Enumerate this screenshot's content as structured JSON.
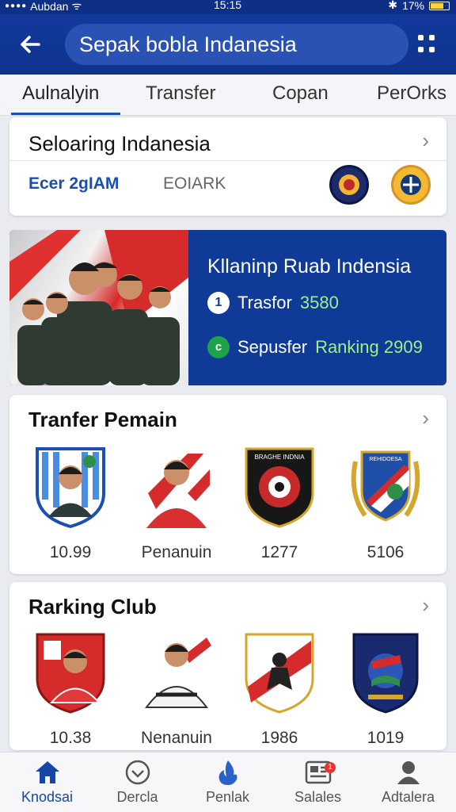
{
  "status": {
    "carrier": "Aubdan",
    "time": "15:15",
    "battery": "17%"
  },
  "header": {
    "search_text": "Sepak bobla Indanesia"
  },
  "tabs": [
    {
      "label": "Aulnalyin",
      "active": true
    },
    {
      "label": "Transfer",
      "active": false
    },
    {
      "label": "Copan",
      "active": false
    },
    {
      "label": "PerOrks",
      "active": false
    }
  ],
  "standings": {
    "title": "Seloaring Indanesia",
    "link": "Ecer 2gIAM",
    "sub": "EOIARK"
  },
  "banner": {
    "title": "Kllaninp Ruab Indensia",
    "row1_label": "Trasfor",
    "row1_value": "3580",
    "row1_icon": "1",
    "row2_label": "Sepusfer",
    "row2_value": "Ranking 2909",
    "row2_icon": "c"
  },
  "transfer": {
    "title": "Tranfer Pemain",
    "items": [
      {
        "value": "10.99",
        "icon": "player-crest-blue"
      },
      {
        "value": "Penanuin",
        "icon": "player-red"
      },
      {
        "value": "1277",
        "icon": "club-crest-black",
        "crest_text": "BRAGHE INDNIA"
      },
      {
        "value": "5106",
        "icon": "club-crest-wreath",
        "crest_text": "REHIDOESA"
      }
    ]
  },
  "ranking": {
    "title": "Rarking Club",
    "items": [
      {
        "value": "10.38",
        "icon": "player-crest-red"
      },
      {
        "value": "Nenanuin",
        "icon": "player-white"
      },
      {
        "value": "1986",
        "icon": "club-crest-redwhite"
      },
      {
        "value": "1019",
        "icon": "club-crest-navy"
      }
    ]
  },
  "nav": [
    {
      "label": "Knodsai",
      "icon": "home-icon",
      "active": true
    },
    {
      "label": "Dercla",
      "icon": "check-circle-icon",
      "active": false
    },
    {
      "label": "Penlak",
      "icon": "flame-icon",
      "active": false
    },
    {
      "label": "Salales",
      "icon": "news-icon",
      "active": false,
      "badge": "1"
    },
    {
      "label": "Adtalera",
      "icon": "person-icon",
      "active": false
    }
  ],
  "colors": {
    "primary": "#123a9c",
    "accent_green": "#9ff08a",
    "link_blue": "#1a4fb0"
  }
}
